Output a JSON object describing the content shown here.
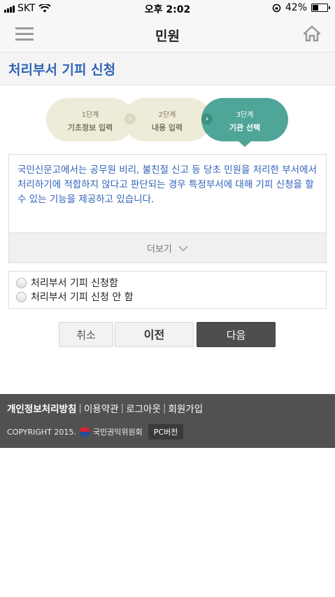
{
  "status_bar": {
    "carrier": "SKT",
    "time": "오후 2:02",
    "battery": "42%",
    "battery_level": 0.42
  },
  "header": {
    "title": "민원"
  },
  "page": {
    "title": "처리부서 기피 신청"
  },
  "steps": [
    {
      "num": "1단계",
      "label": "기초정보 입력",
      "active": false
    },
    {
      "num": "2단계",
      "label": "내용 입력",
      "active": false
    },
    {
      "num": "3단계",
      "label": "기관 선택",
      "active": true
    }
  ],
  "info": {
    "text": "국민신문고에서는 공무원 비리, 불친절 신고 등 당초 민원을 처리한 부서에서 처리하기에 적합하지 않다고 판단되는 경우 특정부서에 대해 기피 신청을 할 수 있는 기능을 제공하고 있습니다.",
    "more_label": "더보기"
  },
  "options": [
    {
      "label": "처리부서 기피 신청함"
    },
    {
      "label": "처리부서 기피 신청 안 함"
    }
  ],
  "buttons": {
    "cancel": "취소",
    "prev": "이전",
    "next": "다음"
  },
  "footer": {
    "links": [
      "개인정보처리방침",
      "이용약관",
      "로그아웃",
      "회원가입"
    ],
    "copyright": "COPYRIGHT 2015.",
    "org": "국민권익위원회",
    "pc_version": "PC버전"
  }
}
